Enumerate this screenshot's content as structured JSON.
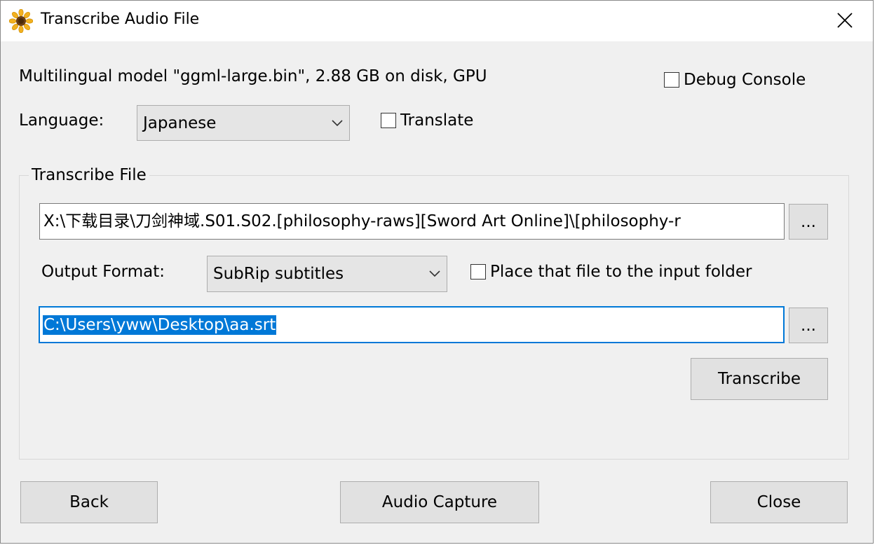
{
  "window": {
    "title": "Transcribe Audio File"
  },
  "model_info": "Multilingual model \"ggml-large.bin\", 2.88 GB on disk, GPU",
  "debug_console": {
    "label": "Debug Console",
    "checked": false
  },
  "language": {
    "label": "Language:",
    "value": "Japanese"
  },
  "translate": {
    "label": "Translate",
    "checked": false
  },
  "transcribe_file": {
    "group_title": "Transcribe File",
    "input_path": "X:\\下载目录\\刀剑神域.S01.S02.[philosophy-raws][Sword Art Online]\\[philosophy-r",
    "browse_input_label": "...",
    "output_format_label": "Output Format:",
    "output_format_value": "SubRip subtitles",
    "place_in_input_folder": {
      "label": "Place that file to the input folder",
      "checked": false
    },
    "output_path": "C:\\Users\\yww\\Desktop\\aa.srt",
    "browse_output_label": "...",
    "transcribe_button": "Transcribe"
  },
  "footer": {
    "back": "Back",
    "audio_capture": "Audio Capture",
    "close": "Close"
  }
}
